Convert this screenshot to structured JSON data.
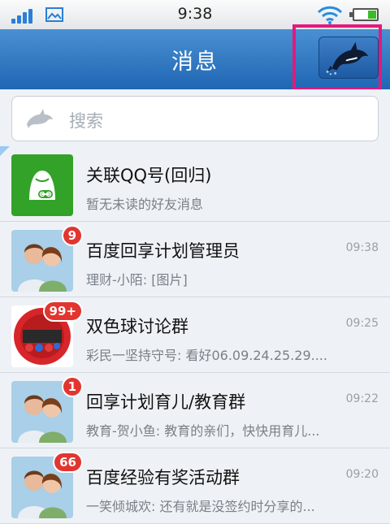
{
  "status_bar": {
    "time": "9:38"
  },
  "header": {
    "title": "消息",
    "dolphin_icon": "dolphin-icon"
  },
  "search": {
    "placeholder": "搜索"
  },
  "conversations": [
    {
      "name": "关联QQ号(回归)",
      "preview": "暂无未读的好友消息",
      "time": "",
      "badge": "",
      "avatar": "qq-green-icon"
    },
    {
      "name": "百度回享计划管理员",
      "preview": "理财-小陌: [图片]",
      "time": "09:38",
      "badge": "9",
      "avatar": "group-avatar"
    },
    {
      "name": "双色球讨论群",
      "preview": "彩民一坚持守号: 看好06.09.24.25.29....",
      "time": "09:25",
      "badge": "99+",
      "avatar": "lottery-avatar"
    },
    {
      "name": "回享计划育儿/教育群",
      "preview": "教育-贺小鱼: 教育的亲们，快快用育儿...",
      "time": "09:22",
      "badge": "1",
      "avatar": "group-avatar"
    },
    {
      "name": "百度经验有奖活动群",
      "preview": "一笑倾城欢: 还有就是没签约时分享的...",
      "time": "09:20",
      "badge": "66",
      "avatar": "group-avatar"
    }
  ],
  "colors": {
    "header": "#2f78c4",
    "highlight": "#e2197d",
    "badge": "#e2352f"
  }
}
